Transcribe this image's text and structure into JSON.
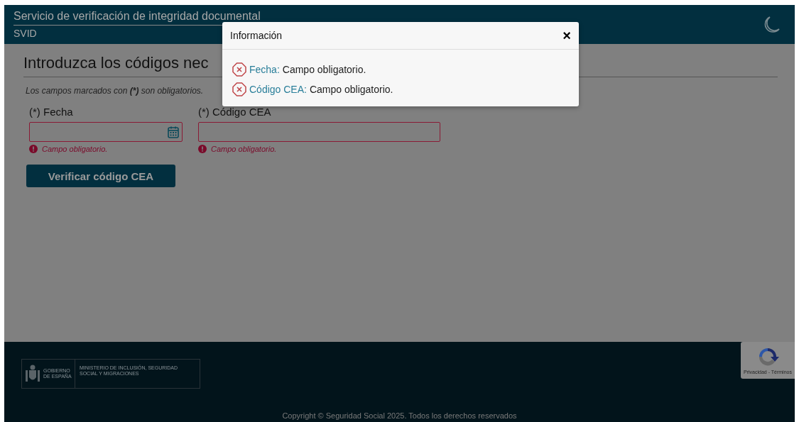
{
  "header": {
    "title": "Servicio de verificación de integridad documental",
    "subtitle": "SVID"
  },
  "form": {
    "heading": "Introduzca los códigos nec",
    "note": "Los campos marcados con **(*)** son obligatorios.",
    "fields": [
      {
        "label": "(*) Fecha",
        "kind": "date",
        "error": "Campo obligatorio."
      },
      {
        "label": "(*) Código CEA",
        "kind": "text",
        "error": "Campo obligatorio."
      }
    ],
    "submit": "Verificar código CEA"
  },
  "modal": {
    "title": "Información",
    "close": "×",
    "errors": [
      {
        "field": "Fecha:",
        "message": "Campo obligatorio."
      },
      {
        "field": "Código CEA:",
        "message": "Campo obligatorio."
      }
    ]
  },
  "footer": {
    "logo_left": "GOBIERNO DE ESPAÑA",
    "logo_right": "MINISTERIO DE INCLUSIÓN, SEGURIDAD SOCIAL Y MIGRACIONES",
    "copyright": "Copyright © Seguridad Social 2025. Todos los derechos reservados"
  },
  "recaptcha": {
    "links": "Privacidad - Términos"
  }
}
